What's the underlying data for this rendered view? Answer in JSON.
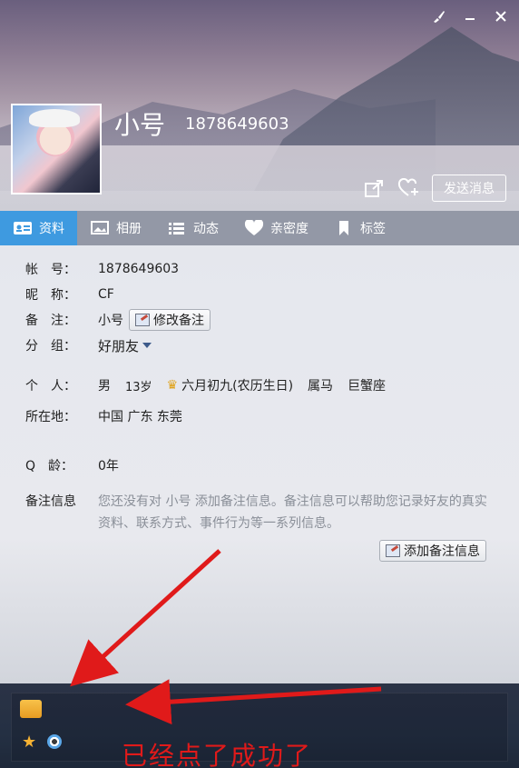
{
  "profile": {
    "nickname": "小号",
    "qq_number": "1878649603"
  },
  "header_actions": {
    "share_icon": "share-icon",
    "add_friend_icon": "heart-plus-icon",
    "send_message_label": "发送消息"
  },
  "window_controls": {
    "skin_icon": "brush-icon",
    "minimize_icon": "minimize-icon",
    "close_icon": "close-icon"
  },
  "tabs": [
    {
      "label": "资料",
      "icon": "profile-card-icon"
    },
    {
      "label": "相册",
      "icon": "photo-icon"
    },
    {
      "label": "动态",
      "icon": "list-icon"
    },
    {
      "label": "亲密度",
      "icon": "heart-icon"
    },
    {
      "label": "标签",
      "icon": "bookmark-icon"
    }
  ],
  "info": {
    "account_label": "帐　号：",
    "account_value": "1878649603",
    "nickname_label": "昵　称：",
    "nickname_value": "CF",
    "remark_label": "备　注：",
    "remark_value": "小号",
    "edit_remark_button": "修改备注",
    "group_label": "分　组：",
    "group_value": "好朋友",
    "personal_label": "个　人：",
    "personal_gender": "男",
    "personal_age": "13岁",
    "personal_birthday": "六月初九(农历生日)",
    "personal_zodiac": "属马",
    "personal_constellation": "巨蟹座",
    "location_label": "所在地：",
    "location_value": "中国 广东 东莞",
    "qage_label": "Q　龄：",
    "qage_value": "0年",
    "notes_label": "备注信息",
    "notes_text": "您还没有对 小号 添加备注信息。备注信息可以帮助您记录好友的真实资料、联系方式、事件行为等一系列信息。",
    "add_notes_button": "添加备注信息"
  },
  "overlay_annotation": "已经点了成功了",
  "colors": {
    "active_tab": "#3e9ae0",
    "annotation_red": "#e01a1a"
  }
}
